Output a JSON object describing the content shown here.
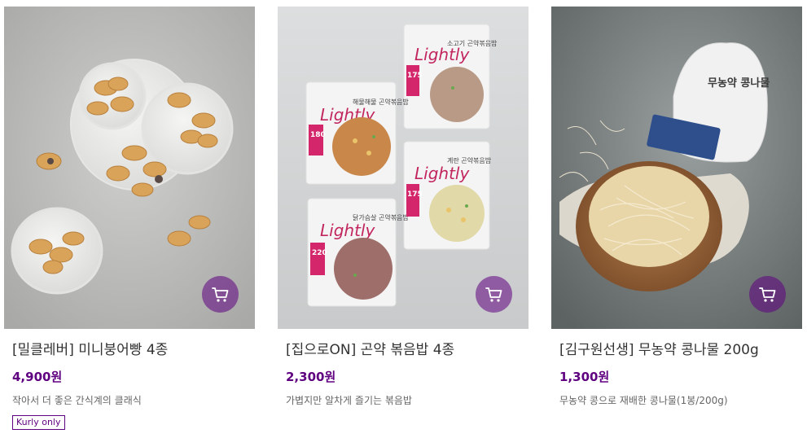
{
  "products": [
    {
      "name": "[밀클레버] 미니붕어빵 4종",
      "price": "4,900원",
      "description": "작아서 더 좋은 간식계의 클래식",
      "badge": "Kurly only",
      "image": "fish-shaped-pastries-photo",
      "cart_icon": "cart-icon"
    },
    {
      "name": "[집으로ON] 곤약 볶음밥 4종",
      "price": "2,300원",
      "description": "가볍지만 알차게 즐기는 볶음밥",
      "image": "konjac-fried-rice-packages-photo",
      "cart_icon": "cart-icon",
      "packages": [
        {
          "brand": "Lightly",
          "flavor": "해물해물 곤약볶음밥",
          "kcal": "180"
        },
        {
          "brand": "Lightly",
          "flavor": "소고기 곤약볶음밥",
          "kcal": "175"
        },
        {
          "brand": "Lightly",
          "flavor": "닭가슴살 곤약볶음밥",
          "kcal": "220"
        },
        {
          "brand": "Lightly",
          "flavor": "계란 곤약볶음밥",
          "kcal": "175"
        }
      ]
    },
    {
      "name": "[김구원선생] 무농약 콩나물 200g",
      "price": "1,300원",
      "description": "무농약 콩으로 재배한 콩나물(1봉/200g)",
      "image": "bean-sprouts-bowl-photo",
      "cart_icon": "cart-icon",
      "bag_label": "무농약 콩나물"
    }
  ],
  "colors": {
    "brand_purple": "#5f0080",
    "cart_button": "rgba(95,0,128,0.55)"
  }
}
